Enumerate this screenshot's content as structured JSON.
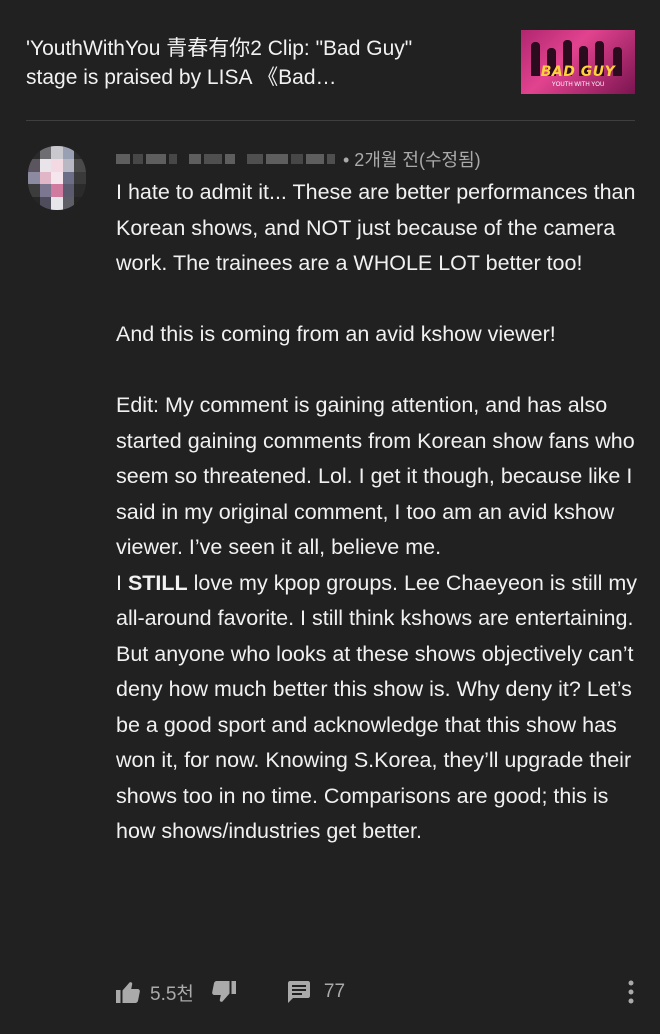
{
  "video": {
    "title": "'YouthWithYou 青春有你2 Clip: \"Bad Guy\"\nstage is praised by LISA 《Bad…",
    "thumbnail_text": "BAD GUY",
    "thumbnail_subtext": "YOUTH WITH YOU"
  },
  "comment": {
    "author": "",
    "timestamp": "• 2개월 전(수정됨)",
    "paragraphs": [
      "I hate to admit it... These are better performances than Korean shows, and NOT just because of the camera work. The trainees are a WHOLE LOT better too!",
      "And this is coming from an avid kshow viewer!",
      "Edit: My comment is gaining attention, and has also started gaining comments from Korean show fans who seem so threatened. Lol. I get it though, because like I said in my original comment, I too am an avid kshow viewer. I’ve seen it all, believe me."
    ],
    "last_prefix": "I ",
    "last_bold": "STILL",
    "last_rest": " love my kpop groups. Lee Chaeyeon is still my all-around favorite. I still think kshows are entertaining. But anyone who looks at these shows objectively can’t deny how much better this show is. Why deny it? Let’s be a good sport and acknowledge that this show has won it, for now. Knowing S.Korea, they’ll upgrade their shows too in no time. Comparisons are good; this is how shows/industries get better."
  },
  "actions": {
    "like_count": "5.5천",
    "reply_count": "77"
  },
  "icons": {
    "like": "thumbs-up-icon",
    "dislike": "thumbs-down-icon",
    "reply": "reply-icon",
    "more": "more-vertical-icon"
  },
  "colors": {
    "background": "#212121",
    "text": "#f1f1f1",
    "secondary": "#aaaaaa",
    "divider": "#3f3f3f"
  }
}
